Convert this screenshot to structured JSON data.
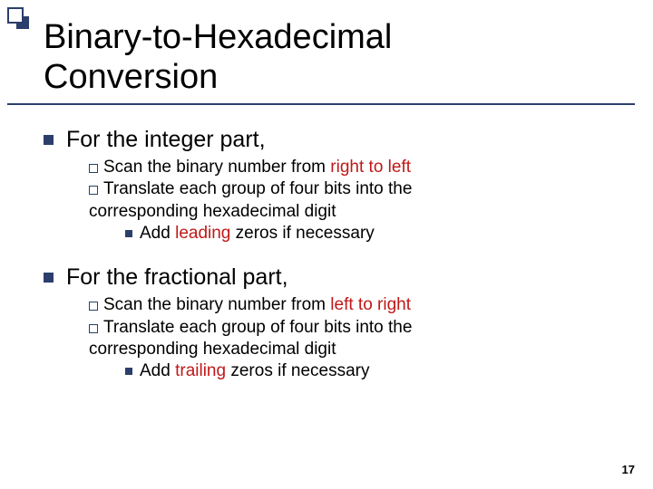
{
  "title_line1": "Binary-to-Hexadecimal",
  "title_line2": "Conversion",
  "section1": {
    "heading": "For the integer part,",
    "b1a": "Scan the binary number from ",
    "b1b": "right to left",
    "b2a": "Translate each group of four bits into the",
    "b2b": "corresponding hexadecimal digit",
    "b3a": "Add ",
    "b3b": "leading",
    "b3c": " zeros if necessary"
  },
  "section2": {
    "heading": "For the fractional part,",
    "b1a": "Scan the binary number from ",
    "b1b": "left to right",
    "b2a": "Translate each group of four bits into the",
    "b2b": "corresponding hexadecimal digit",
    "b3a": "Add ",
    "b3b": "trailing",
    "b3c": " zeros if necessary"
  },
  "page_number": "17"
}
